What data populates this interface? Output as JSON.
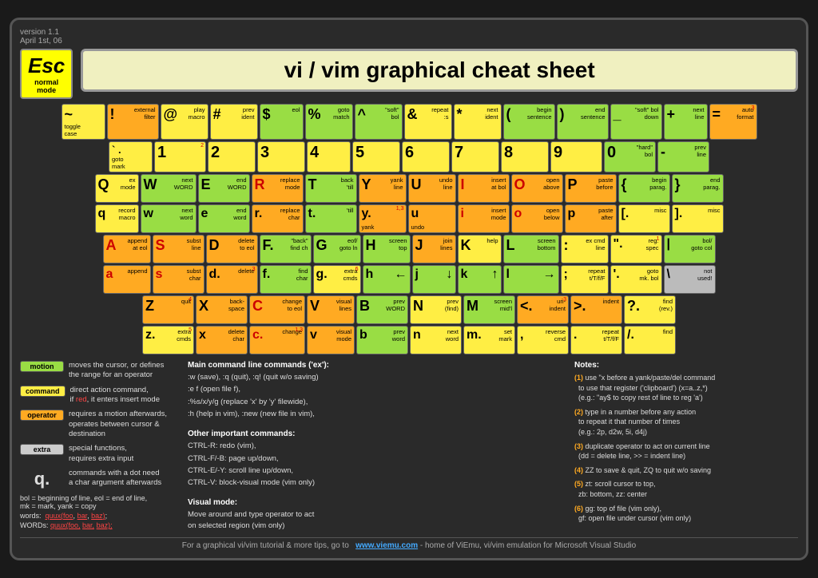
{
  "meta": {
    "version": "version 1.1",
    "date": "April 1st, 06"
  },
  "title": "vi / vim graphical cheat sheet",
  "esc": {
    "label": "Esc",
    "sub1": "normal",
    "sub2": "mode"
  },
  "row1": [
    {
      "main": "~",
      "desc": "toggle\ncase",
      "color": "yellow"
    },
    {
      "main": "!",
      "sub": "external\nfilter",
      "color": "orange"
    },
    {
      "main": "@",
      "sub": "play\nmacro",
      "color": "yellow"
    },
    {
      "main": "#",
      "sub": "prev\nident",
      "color": "yellow"
    },
    {
      "main": "$",
      "sub": "eol",
      "color": "green"
    },
    {
      "main": "%",
      "sub": "goto\nmatch",
      "color": "green"
    },
    {
      "main": "^",
      "sub": "\"soft\"\nbol",
      "color": "green"
    },
    {
      "main": "&",
      "sub": "repeat\n:s",
      "color": "yellow"
    },
    {
      "main": "*",
      "sub": "next\nident",
      "color": "yellow"
    },
    {
      "main": "(",
      "sub": "begin\nsentence",
      "color": "green"
    },
    {
      "main": ")",
      "sub": "end\nsentence",
      "color": "green"
    },
    {
      "main": "_",
      "sub": "\"soft\" bol\ndown",
      "color": "green"
    },
    {
      "main": "+",
      "sub": "next\nline",
      "color": "green"
    },
    {
      "main": "=",
      "sub": "auto\nformat",
      "color": "orange",
      "supernum": "3"
    }
  ],
  "row1b": [
    {
      "main": "`, .",
      "sub": "goto\nmark",
      "color": "yellow"
    },
    {
      "main": "1",
      "supernum": "2",
      "color": "yellow"
    },
    {
      "main": "2",
      "color": "yellow"
    },
    {
      "main": "3",
      "color": "yellow"
    },
    {
      "main": "4",
      "color": "yellow"
    },
    {
      "main": "5",
      "color": "yellow"
    },
    {
      "main": "6",
      "color": "yellow"
    },
    {
      "main": "7",
      "color": "yellow"
    },
    {
      "main": "8",
      "color": "yellow"
    },
    {
      "main": "9",
      "color": "yellow"
    },
    {
      "main": "0",
      "sub": "\"hard\"\nbol",
      "color": "green"
    },
    {
      "main": "-",
      "sub": "prev\nline",
      "color": "green"
    }
  ],
  "legend": {
    "motion": {
      "label": "motion",
      "desc": "moves the cursor, or defines\nthe range for an operator"
    },
    "command": {
      "label": "command",
      "desc": "direct action command,\nif red, it enters insert mode"
    },
    "operator": {
      "label": "operator",
      "desc": "requires a motion afterwards,\noperates between cursor &\ndestination"
    },
    "extra": {
      "label": "extra",
      "desc": "special functions,\nrequires extra input"
    },
    "dot_note": "commands with a dot need\na char argument afterwards",
    "bol_note": "bol = beginning of line, eol = end of line,\nmk = mark, yank = copy",
    "words_label": "words:",
    "words_code": "quux(foo, bar, baz);",
    "WORDs_label": "WORDs:",
    "WORDs_code": "quux(foo, bar, baz);"
  },
  "main_commands": {
    "title": "Main command line commands ('ex'):",
    "items": [
      ":w (save), :q (quit), :q! (quit w/o saving)",
      ":e f (open file f),",
      ":%s/x/y/g (replace 'x' by 'y' filewide),",
      ":h (help in vim), :new (new file in vim),"
    ]
  },
  "other_commands": {
    "title": "Other important commands:",
    "items": [
      "CTRL-R: redo (vim),",
      "CTRL-F/-B: page up/down,",
      "CTRL-E/-Y: scroll line up/down,",
      "CTRL-V: block-visual mode (vim only)"
    ]
  },
  "visual_mode": {
    "title": "Visual mode:",
    "desc": "Move around and type operator to act\non selected region (vim only)"
  },
  "notes": {
    "title": "Notes:",
    "items": [
      {
        "num": "(1)",
        "text": "use \"x before a yank/paste/del command\n  to use that register ('clipboard') (x=a..z,*)\n  (e.g.: \"ay$ to copy rest of line to reg 'a')"
      },
      {
        "num": "(2)",
        "text": "type in a number before any action\n  to repeat it that number of times\n  (e.g.: 2p, d2w, 5i, d4j)"
      },
      {
        "num": "(3)",
        "text": "duplicate operator to act on current line\n  (dd = delete line, >> = indent line)"
      },
      {
        "num": "(4)",
        "text": "ZZ to save & quit, ZQ to quit w/o saving"
      },
      {
        "num": "(5)",
        "text": "zt: scroll cursor to top,\n  zb: bottom, zz: center"
      },
      {
        "num": "(6)",
        "text": "gg: top of file (vim only),\n  gf: open file under cursor (vim only)"
      }
    ]
  },
  "footer": {
    "text": "For a graphical vi/vim tutorial & more tips, go to",
    "url": "www.viemu.com",
    "suffix": " - home of ViEmu, vi/vim emulation for Microsoft Visual Studio"
  }
}
